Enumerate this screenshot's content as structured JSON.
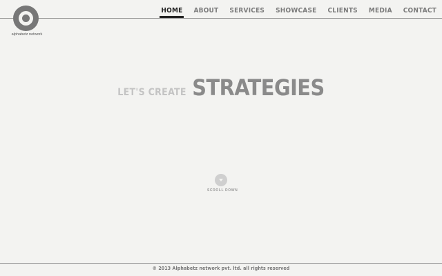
{
  "brand": {
    "logo_icon": "at-sign-logo",
    "name": "alphabetz network"
  },
  "nav": {
    "items": [
      {
        "label": "HOME",
        "active": true
      },
      {
        "label": "ABOUT",
        "active": false
      },
      {
        "label": "SERVICES",
        "active": false
      },
      {
        "label": "SHOWCASE",
        "active": false
      },
      {
        "label": "CLIENTS",
        "active": false
      },
      {
        "label": "MEDIA",
        "active": false
      },
      {
        "label": "CONTACT",
        "active": false
      }
    ]
  },
  "hero": {
    "lead": "LET'S CREATE",
    "headline": "STRATEGIES"
  },
  "scroll": {
    "icon": "chevron-down-icon",
    "label": "SCROLL DOWN"
  },
  "footer": {
    "text": "© 2013 Alphabetz network pvt. ltd. all rights reserved"
  },
  "colors": {
    "background": "#f3f3f1",
    "nav_active": "#222222",
    "nav_inactive": "#7b7b7b",
    "headline": "#8a8a8a",
    "lead": "#c4c4c4"
  }
}
